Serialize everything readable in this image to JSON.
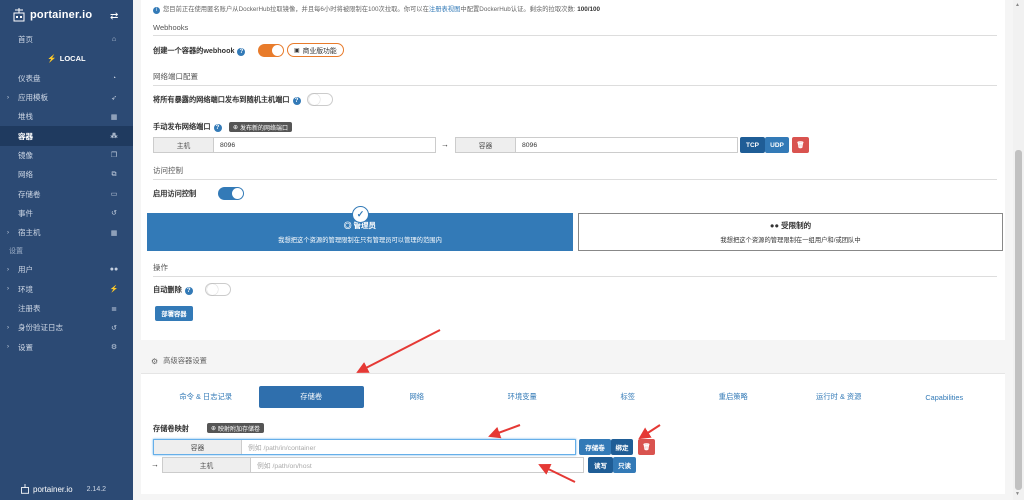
{
  "sidebar": {
    "brand": "portainer.io",
    "local_label": "LOCAL",
    "settings_section": "设置",
    "items": [
      {
        "label": "首页",
        "icon": "home-icon",
        "glyph": "⌂"
      },
      {
        "label": "仪表盘",
        "icon": "dashboard-icon",
        "glyph": "◔"
      },
      {
        "label": "应用模板",
        "icon": "rocket-icon",
        "glyph": "➶"
      },
      {
        "label": "堆栈",
        "icon": "grid-icon",
        "glyph": "▦"
      },
      {
        "label": "容器",
        "icon": "cubes-icon",
        "glyph": "⁂"
      },
      {
        "label": "镜像",
        "icon": "clone-icon",
        "glyph": "❐"
      },
      {
        "label": "网络",
        "icon": "sitemap-icon",
        "glyph": "⧉"
      },
      {
        "label": "存储卷",
        "icon": "hdd-icon",
        "glyph": "▭"
      },
      {
        "label": "事件",
        "icon": "history-icon",
        "glyph": "↺"
      },
      {
        "label": "宿主机",
        "icon": "th-icon",
        "glyph": "▦"
      }
    ],
    "settings_items": [
      {
        "label": "用户",
        "icon": "users-icon",
        "glyph": "👥"
      },
      {
        "label": "环境",
        "icon": "plug-icon",
        "glyph": "⚡"
      },
      {
        "label": "注册表",
        "icon": "database-icon",
        "glyph": "≣"
      },
      {
        "label": "身份验证日志",
        "icon": "history-icon",
        "glyph": "↺"
      },
      {
        "label": "设置",
        "icon": "cogs-icon",
        "glyph": "⚙"
      }
    ],
    "footer_brand": "portainer.io",
    "version": "2.14.2"
  },
  "main": {
    "info": {
      "text": "您目前正在使用匿名账户从DockerHub拉取镜像，并且每6小时将被限制在100次拉取。你可以在",
      "link": "注册表视图",
      "text2": "中配置DockerHub认证。剩余的拉取次数:",
      "remaining": "100/100"
    },
    "webhooks": {
      "section": "Webhooks",
      "label": "创建一个容器的webhook",
      "biz_label": "商业版功能"
    },
    "ports": {
      "section": "网络端口配置",
      "publish_all_label": "将所有暴露的网络端口发布到随机主机端口",
      "manual_label": "手动发布网络端口",
      "add_btn": "发布新的网络端口",
      "host_addon": "主机",
      "host_value": "8096",
      "arrow": "→",
      "container_addon": "容器",
      "container_value": "8096",
      "tcp": "TCP",
      "udp": "UDP"
    },
    "access": {
      "section": "访问控制",
      "enable_label": "启用访问控制",
      "admin_title": "管理员",
      "admin_desc": "我想把这个资源的管理限制在只有管理员可以管理的范围内",
      "restricted_title": "受限制的",
      "restricted_desc": "我想把这个资源的管理限制在一组用户和/或团队中"
    },
    "actions": {
      "section": "操作",
      "autoremove_label": "自动删除",
      "deploy_btn": "部署容器"
    },
    "advanced": {
      "header": "高级容器设置",
      "tabs": [
        "命令 & 日志记录",
        "存储卷",
        "网络",
        "环境变量",
        "标签",
        "重启策略",
        "运行时 & 资源",
        "Capabilities"
      ],
      "active_tab": 1,
      "volume_mapping_label": "存储卷映射",
      "add_volume_btn": "映射附加存储卷",
      "container_addon": "容器",
      "container_placeholder": "例如 /path/in/container",
      "volume_btn": "存储卷",
      "bind_btn": "绑定",
      "arrow": "→",
      "host_addon": "主机",
      "host_placeholder": "例如 /path/on/host",
      "rw_btn": "读写",
      "ro_btn": "只读"
    }
  },
  "colors": {
    "sidebar": "#2c4a74",
    "primary": "#337ab7",
    "danger": "#d9534f",
    "orange": "#e87b2b",
    "annotation": "#e53935"
  }
}
